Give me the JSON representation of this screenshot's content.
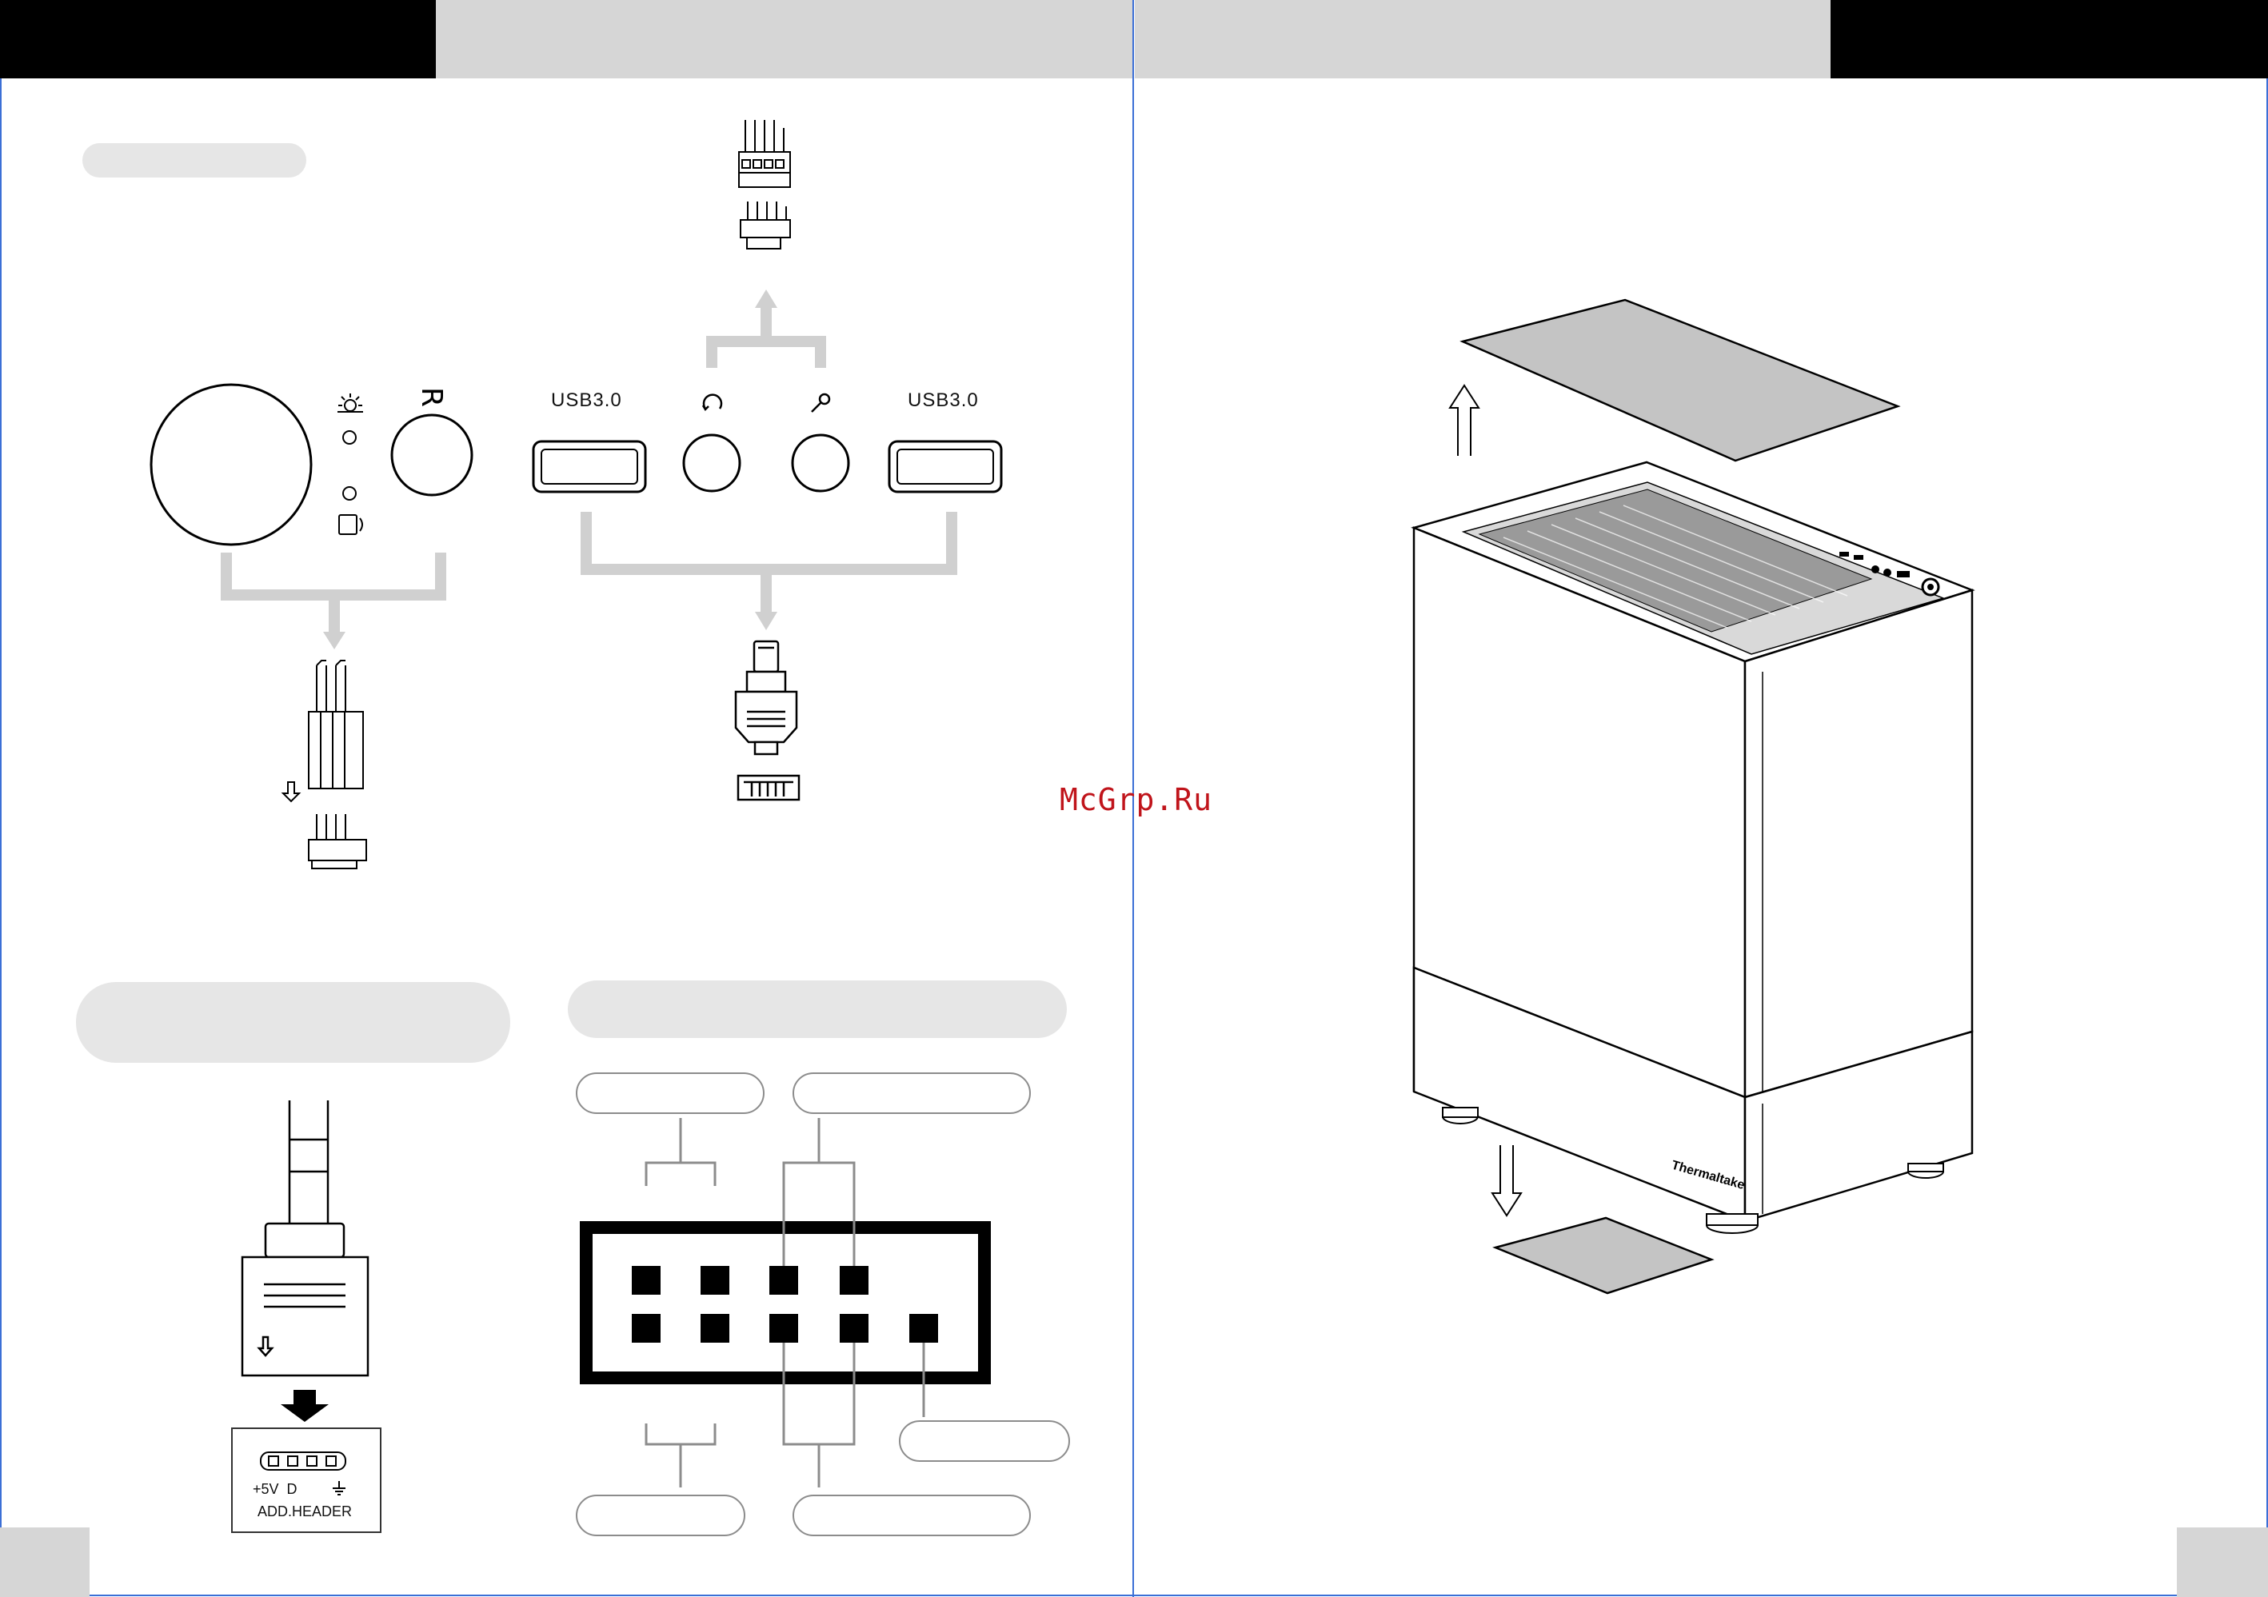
{
  "left_page": {
    "io_panel": {
      "usb_left_label": "USB3.0",
      "usb_right_label": "USB3.0",
      "reset_symbol": "R",
      "icons": [
        "led-sun-icon",
        "hdd-icon",
        "headphone-icon",
        "microphone-icon",
        "power-button-icon"
      ]
    },
    "argb_connector": {
      "pin_labels": "+5V  D",
      "header_label": "ADD.HEADER"
    }
  },
  "right_page": {
    "case_brand_logo": "Thermaltake"
  },
  "watermark": "McGrp.Ru",
  "colors": {
    "header_black": "#000000",
    "header_gray": "#d6d6d6",
    "pill_gray": "#e6e6e6",
    "divider_blue": "#3b6fd6",
    "watermark_red": "#c0141b",
    "filter_gray": "#c4c4c4"
  }
}
